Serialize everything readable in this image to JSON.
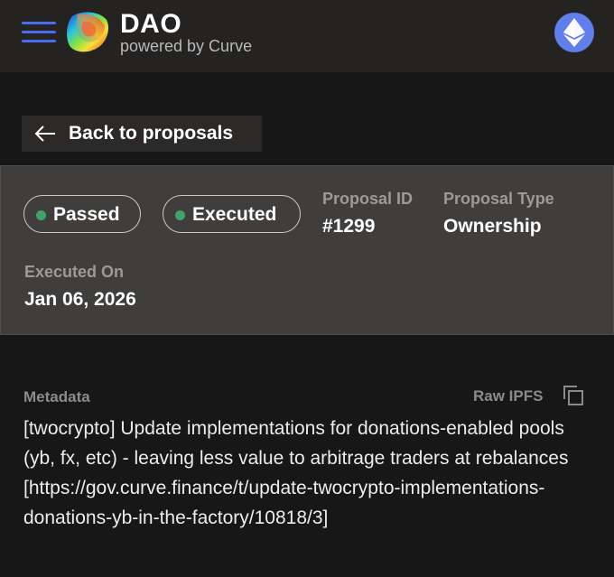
{
  "header": {
    "title": "DAO",
    "subtitle": "powered by Curve",
    "menu_icon": "hamburger-menu-icon",
    "logo": "curve-logo",
    "network_icon": "ethereum-icon"
  },
  "back": {
    "label": "Back to proposals",
    "icon": "arrow-left-icon"
  },
  "proposal": {
    "status_badges": [
      "Passed",
      "Executed"
    ],
    "badge_dot_color": "#3fa36b",
    "id_label": "Proposal ID",
    "id_value": "#1299",
    "type_label": "Proposal Type",
    "type_value": "Ownership",
    "executed_label": "Executed On",
    "executed_value": "Jan 06, 2026"
  },
  "metadata": {
    "label": "Metadata",
    "raw_ipfs_label": "Raw IPFS",
    "copy_icon": "copy-icon",
    "text": "[twocrypto] Update implementations for donations-enabled pools (yb, fx, etc) - leaving less value to arbitrage traders at rebalances [https://gov.curve.finance/t/update-twocrypto-implementations-donations-yb-in-the-factory/10818/3]"
  },
  "colors": {
    "background": "#171717",
    "header_bg": "#242322",
    "panel_bg": "#3f3e3d",
    "accent_blue": "#4a6cf0",
    "ethereum": "#627eea"
  }
}
